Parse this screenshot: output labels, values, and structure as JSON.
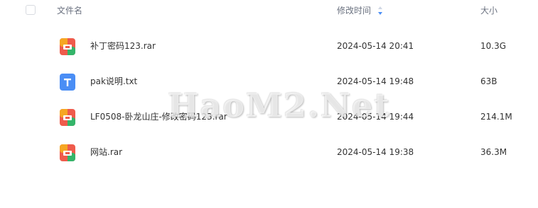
{
  "header": {
    "name_label": "文件名",
    "time_label": "修改时间",
    "size_label": "大小"
  },
  "files": [
    {
      "name": "补丁密码123.rar",
      "modified": "2024-05-14 20:41",
      "size": "10.3G",
      "icon": "rar-archive-icon"
    },
    {
      "name": "pak说明.txt",
      "modified": "2024-05-14 19:48",
      "size": "63B",
      "icon": "txt-file-icon"
    },
    {
      "name": "LF0508-卧龙山庄-修改密码123.rar",
      "modified": "2024-05-14 19:44",
      "size": "214.1M",
      "icon": "rar-archive-icon"
    },
    {
      "name": "网站.rar",
      "modified": "2024-05-14 19:38",
      "size": "36.3M",
      "icon": "rar-archive-icon"
    }
  ],
  "watermark": "HaoM2.Net",
  "colors": {
    "txt_icon": "#4a8ef5",
    "rar_red": "#ef5b4c",
    "rar_green": "#34b56a",
    "rar_orange": "#f6a623",
    "sort_icon": "#4a8ef5"
  }
}
